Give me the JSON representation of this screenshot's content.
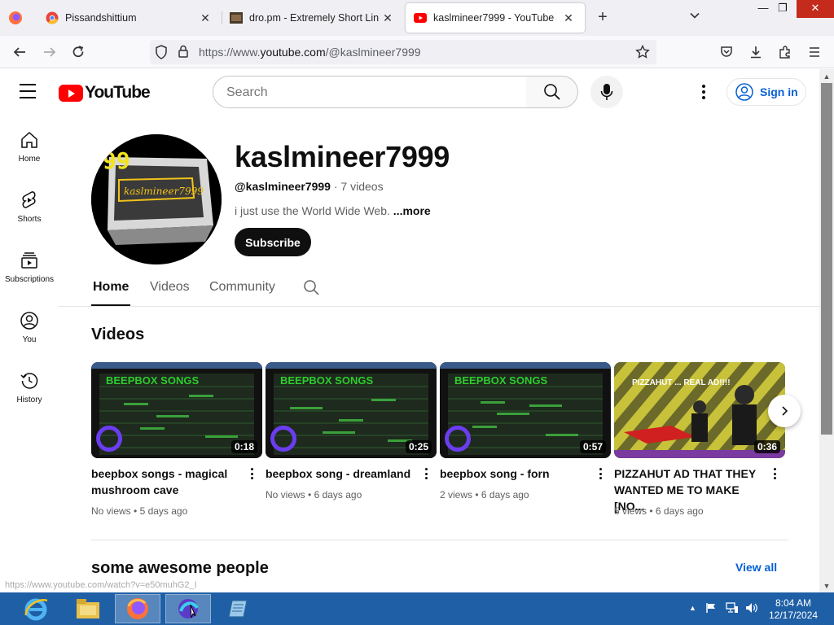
{
  "browser": {
    "tabs": [
      {
        "title": "Pissandshittium",
        "active": false
      },
      {
        "title": "dro.pm - Extremely Short Links",
        "active": false
      },
      {
        "title": "kaslmineer7999 - YouTube",
        "active": true
      }
    ],
    "url_prefix": "https://www.",
    "url_domain": "youtube.com",
    "url_path": "/@kaslmineer7999",
    "status_url": "https://www.youtube.com/watch?v=e50muhG2_I"
  },
  "header": {
    "logo_text": "YouTube",
    "search_placeholder": "Search",
    "signin_label": "Sign in"
  },
  "guide": {
    "items": [
      {
        "label": "Home",
        "icon": "home-icon"
      },
      {
        "label": "Shorts",
        "icon": "shorts-icon"
      },
      {
        "label": "Subscriptions",
        "icon": "subscriptions-icon"
      },
      {
        "label": "You",
        "icon": "you-icon"
      },
      {
        "label": "History",
        "icon": "history-icon"
      }
    ]
  },
  "channel": {
    "name": "kaslmineer7999",
    "handle": "@kaslmineer7999",
    "separator": " · ",
    "video_count": "7 videos",
    "description": "i just use the World Wide Web. ",
    "more_label": "...more",
    "subscribe_label": "Subscribe",
    "avatar_number": "99",
    "avatar_text": "kaslmineer7999",
    "tabs": [
      "Home",
      "Videos",
      "Community"
    ]
  },
  "videos_section": {
    "title": "Videos",
    "videos": [
      {
        "title_line1": "beepbox songs - magical",
        "title_line2": "mushroom cave",
        "duration": "0:18",
        "views": "No views",
        "age": "5 days ago",
        "thumb_overlay": "BEEPBOX SONGS"
      },
      {
        "title_line1": "beepbox song - dreamland",
        "title_line2": "",
        "duration": "0:25",
        "views": "No views",
        "age": "6 days ago",
        "thumb_overlay": "BEEPBOX SONGS"
      },
      {
        "title_line1": "beepbox song - forn",
        "title_line2": "",
        "duration": "0:57",
        "views": "2 views",
        "age": "6 days ago",
        "thumb_overlay": "BEEPBOX SONGS"
      },
      {
        "title_line1": "PIZZAHUT AD THAT THEY",
        "title_line2": "WANTED ME TO MAKE [NO...",
        "duration": "0:36",
        "views": "5 views",
        "age": "6 days ago",
        "thumb_overlay": "PIZZAHUT ... REAL AD!!!!"
      }
    ],
    "meta_sep": " • "
  },
  "people_section": {
    "title": "some awesome people",
    "view_all_label": "View all"
  },
  "taskbar": {
    "time": "8:04 AM",
    "date": "12/17/2024"
  },
  "colors": {
    "yt_red": "#ff0000",
    "link_blue": "#065fd4",
    "taskbar_blue": "#1f5fa6"
  }
}
